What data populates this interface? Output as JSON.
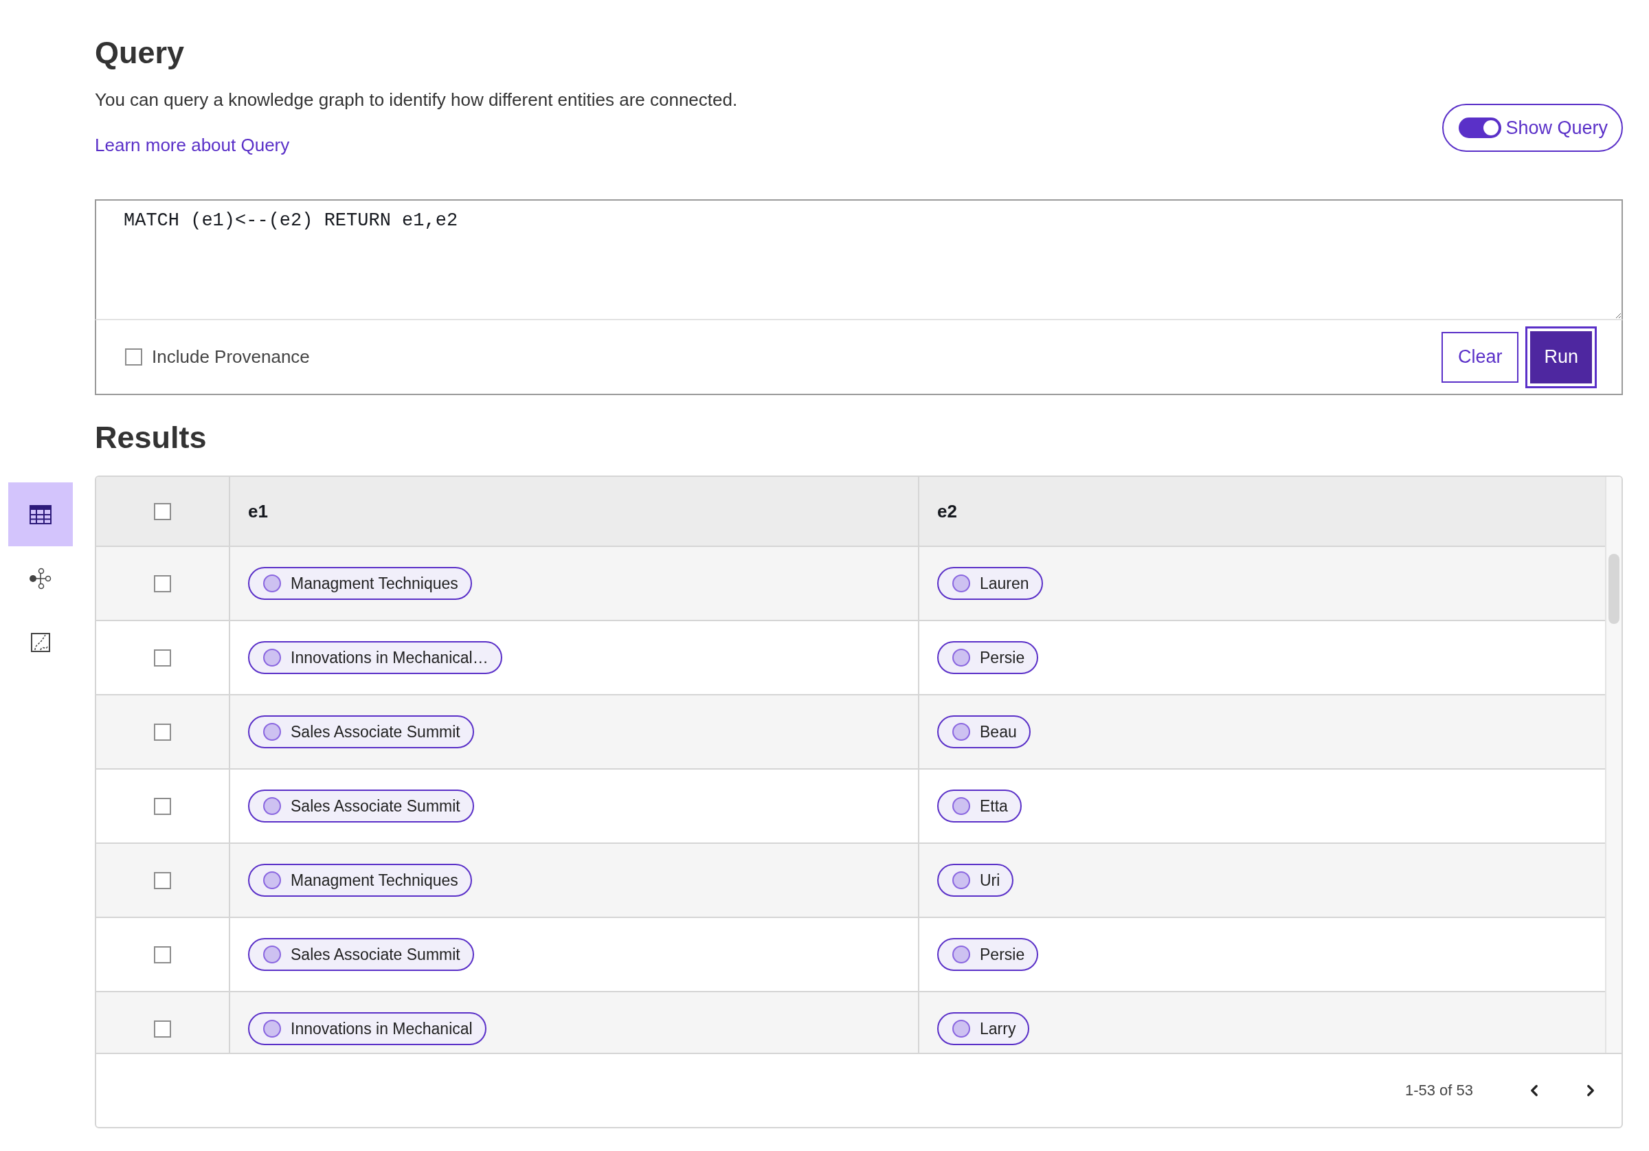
{
  "page": {
    "title": "Query",
    "description": "You can query a knowledge graph to identify how different entities are connected.",
    "learn_more_link": "Learn more about Query"
  },
  "show_query_toggle": {
    "label": "Show Query",
    "on": true
  },
  "query": {
    "value": "MATCH (e1)<--(e2) RETURN e1,e2"
  },
  "include_provenance": {
    "label": "Include Provenance",
    "checked": false
  },
  "buttons": [
    {
      "label": "Clear",
      "kind": "secondary"
    },
    {
      "label": "Run",
      "kind": "primary"
    }
  ],
  "view_modes": [
    {
      "kind": "table",
      "selected": true
    },
    {
      "kind": "graph",
      "selected": false
    },
    {
      "kind": "chart",
      "selected": false
    }
  ],
  "results": {
    "title": "Results",
    "select_all_checked": false,
    "columns": [
      "e1",
      "e2"
    ],
    "rows": [
      {
        "checked": false,
        "e1": "Managment Techniques",
        "e2": "Lauren"
      },
      {
        "checked": false,
        "e1": "Innovations in Mechanical…",
        "e2": "Persie"
      },
      {
        "checked": false,
        "e1": "Sales Associate Summit",
        "e2": "Beau"
      },
      {
        "checked": false,
        "e1": "Sales Associate Summit",
        "e2": "Etta"
      },
      {
        "checked": false,
        "e1": "Managment Techniques",
        "e2": "Uri"
      },
      {
        "checked": false,
        "e1": "Sales Associate Summit",
        "e2": "Persie"
      },
      {
        "checked": false,
        "e1": "Innovations in Mechanical",
        "e2": "Larry"
      }
    ],
    "pagination": "1-53 of 53"
  }
}
